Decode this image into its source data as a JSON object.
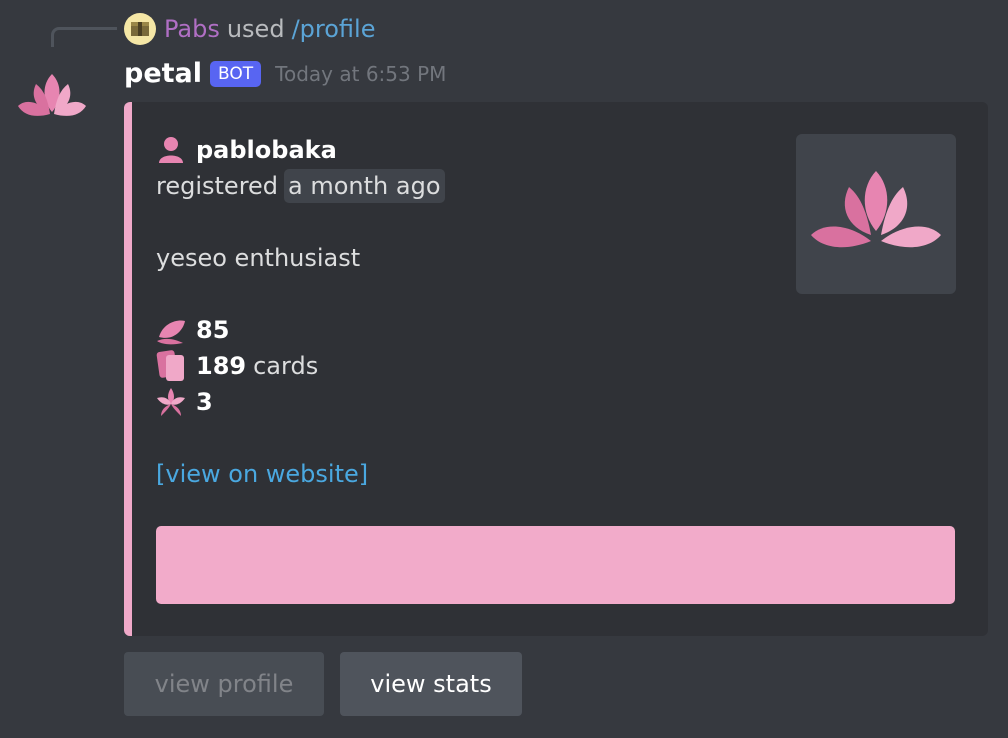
{
  "reply": {
    "user": "Pabs",
    "used_text": "used",
    "command": "/profile"
  },
  "message": {
    "author": "petal",
    "badge": "BOT",
    "timestamp": "Today at 6:53 PM"
  },
  "embed": {
    "username": "pablobaka",
    "registered_label": "registered",
    "registered_value": "a month ago",
    "bio": "yeseo enthusiast",
    "stat_petals": "85",
    "stat_cards_count": "189",
    "stat_cards_label": "cards",
    "stat_flowers": "3",
    "website_link": "[view on website]",
    "accent_color": "#f2abca"
  },
  "buttons": {
    "view_profile": "view profile",
    "view_stats": "view stats"
  }
}
